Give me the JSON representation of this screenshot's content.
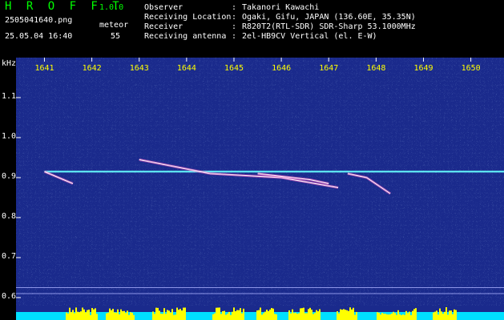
{
  "header": {
    "app_title": "H R O F F T",
    "version": "1.0.0",
    "filename": "2505041640.png",
    "mode": "meteor",
    "datetime": "25.05.04 16:40",
    "count": "55",
    "meta": [
      {
        "key": "Observer",
        "value": "Takanori Kawachi"
      },
      {
        "key": "Receiving Location",
        "value": "Ogaki, Gifu, JAPAN (136.60E, 35.35N)"
      },
      {
        "key": "Receiver",
        "value": "R820T2(RTL-SDR) SDR-Sharp 53.1000MHz"
      },
      {
        "key": "Receiving antenna",
        "value": "2el-HB9CV Vertical (el. E-W)"
      }
    ],
    "colon": ":"
  },
  "chart_data": {
    "type": "heatmap",
    "ylabel": "kHz",
    "ylim": [
      0.58,
      1.2
    ],
    "yticks": [
      "1.1",
      "1.0",
      "0.9",
      "0.8",
      "0.7",
      "0.6"
    ],
    "ytick_values": [
      1.1,
      1.0,
      0.9,
      0.8,
      0.7,
      0.6
    ],
    "xticks": [
      "1641",
      "1642",
      "1643",
      "1644",
      "1645",
      "1646",
      "1647",
      "1648",
      "1649",
      "1650"
    ],
    "xtick_values": [
      1641,
      1642,
      1643,
      1644,
      1645,
      1646,
      1647,
      1648,
      1649,
      1650
    ],
    "xlim": [
      1640.4,
      1650.7
    ],
    "carrier_freq": 0.915,
    "traces": [
      {
        "points": [
          [
            1641.0,
            0.915
          ],
          [
            1641.6,
            0.885
          ]
        ]
      },
      {
        "points": [
          [
            1643.0,
            0.945
          ],
          [
            1644.5,
            0.91
          ],
          [
            1646.0,
            0.9
          ],
          [
            1647.2,
            0.875
          ]
        ]
      },
      {
        "points": [
          [
            1645.5,
            0.91
          ],
          [
            1646.6,
            0.895
          ],
          [
            1647.0,
            0.885
          ]
        ]
      },
      {
        "points": [
          [
            1647.4,
            0.91
          ],
          [
            1647.8,
            0.9
          ],
          [
            1648.3,
            0.86
          ]
        ]
      }
    ],
    "colors": {
      "background": "#1a2a8c",
      "carrier": "#66ffff",
      "trace": "#ffffff",
      "tick_label": "#ffff00",
      "level_bar": "#ffff00",
      "level_base": "#00e0ff"
    }
  }
}
